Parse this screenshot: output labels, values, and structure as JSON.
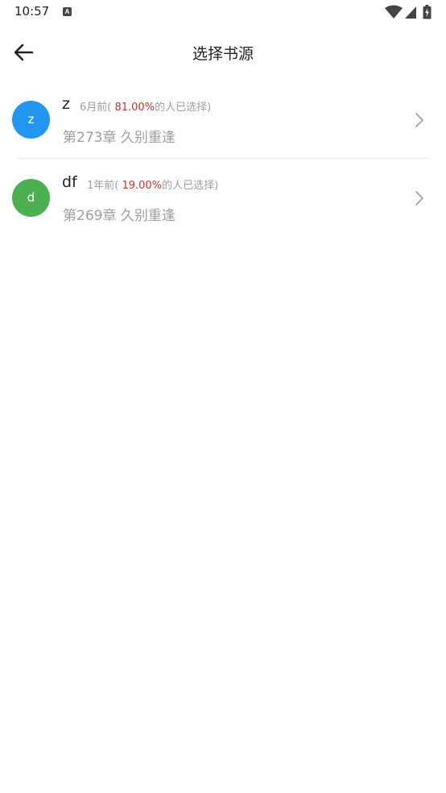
{
  "status_bar": {
    "time": "10:57",
    "notification_glyph": "A",
    "icons": [
      "wifi-icon",
      "cellular-signal-icon",
      "battery-charging-icon"
    ]
  },
  "app_bar": {
    "title": "选择书源",
    "back_icon": "arrow-left-icon"
  },
  "sources": [
    {
      "avatar_letter": "z",
      "avatar_color": "#2196F3",
      "name": "z",
      "time_ago": "6月前",
      "open_paren": "(",
      "percent": " 81.00%",
      "suffix": "的人已选择)",
      "chapter": "第273章 久别重逢"
    },
    {
      "avatar_letter": "d",
      "avatar_color": "#4CAF50",
      "name": "df",
      "time_ago": "1年前",
      "open_paren": "(",
      "percent": " 19.00%",
      "suffix": "的人已选择)",
      "chapter": "第269章 久别重逢"
    }
  ],
  "colors": {
    "percent_highlight": "#d32f2f",
    "secondary_text": "#9e9e9e"
  }
}
